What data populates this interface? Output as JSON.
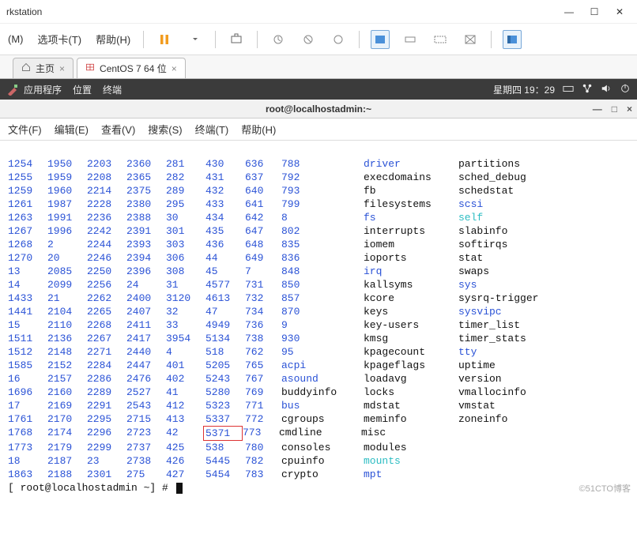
{
  "window": {
    "title": "rkstation"
  },
  "menubar": {
    "items": [
      {
        "label": "(M)"
      },
      {
        "label": "选项卡(T)"
      },
      {
        "label": "帮助(H)"
      }
    ]
  },
  "tabs": [
    {
      "label": "主页",
      "active": false,
      "has_close": true
    },
    {
      "label": "CentOS 7 64 位",
      "active": true,
      "has_close": true
    }
  ],
  "linux_bar": {
    "apps": "应用程序",
    "place": "位置",
    "term": "终端",
    "clock": "星期四 19：29"
  },
  "terminal": {
    "title": "root@localhostadmin:~",
    "menu": [
      "文件(F)",
      "编辑(E)",
      "查看(V)",
      "搜索(S)",
      "终端(T)",
      "帮助(H)"
    ],
    "prompt": "[ root@localhostadmin ~] #",
    "highlight_cell": "5371",
    "rows": [
      {
        "c0": "1254",
        "c1": "1950",
        "c2": "2203",
        "c3": "2360",
        "c4": "281",
        "c5": "430",
        "c6": "636",
        "c7": "788",
        "c8": "driver",
        "c9": "partitions",
        "cls": {
          "c8": "blue"
        }
      },
      {
        "c0": "1255",
        "c1": "1959",
        "c2": "2208",
        "c3": "2365",
        "c4": "282",
        "c5": "431",
        "c6": "637",
        "c7": "792",
        "c8": "execdomains",
        "c9": "sched_debug"
      },
      {
        "c0": "1259",
        "c1": "1960",
        "c2": "2214",
        "c3": "2375",
        "c4": "289",
        "c5": "432",
        "c6": "640",
        "c7": "793",
        "c8": "fb",
        "c9": "schedstat"
      },
      {
        "c0": "1261",
        "c1": "1987",
        "c2": "2228",
        "c3": "2380",
        "c4": "295",
        "c5": "433",
        "c6": "641",
        "c7": "799",
        "c8": "filesystems",
        "c9": "scsi",
        "cls": {
          "c9": "blue"
        }
      },
      {
        "c0": "1263",
        "c1": "1991",
        "c2": "2236",
        "c3": "2388",
        "c4": "30",
        "c5": "434",
        "c6": "642",
        "c7": "8",
        "c8": "fs",
        "c9": "self",
        "cls": {
          "c8": "blue",
          "c9": "cyan"
        }
      },
      {
        "c0": "1267",
        "c1": "1996",
        "c2": "2242",
        "c3": "2391",
        "c4": "301",
        "c5": "435",
        "c6": "647",
        "c7": "802",
        "c8": "interrupts",
        "c9": "slabinfo"
      },
      {
        "c0": "1268",
        "c1": "2",
        "c2": "2244",
        "c3": "2393",
        "c4": "303",
        "c5": "436",
        "c6": "648",
        "c7": "835",
        "c8": "iomem",
        "c9": "softirqs"
      },
      {
        "c0": "1270",
        "c1": "20",
        "c2": "2246",
        "c3": "2394",
        "c4": "306",
        "c5": "44",
        "c6": "649",
        "c7": "836",
        "c8": "ioports",
        "c9": "stat"
      },
      {
        "c0": "13",
        "c1": "2085",
        "c2": "2250",
        "c3": "2396",
        "c4": "308",
        "c5": "45",
        "c6": "7",
        "c7": "848",
        "c8": "irq",
        "c9": "swaps",
        "cls": {
          "c8": "blue"
        }
      },
      {
        "c0": "14",
        "c1": "2099",
        "c2": "2256",
        "c3": "24",
        "c4": "31",
        "c5": "4577",
        "c6": "731",
        "c7": "850",
        "c8": "kallsyms",
        "c9": "sys",
        "cls": {
          "c9": "blue"
        }
      },
      {
        "c0": "1433",
        "c1": "21",
        "c2": "2262",
        "c3": "2400",
        "c4": "3120",
        "c5": "4613",
        "c6": "732",
        "c7": "857",
        "c8": "kcore",
        "c9": "sysrq-trigger"
      },
      {
        "c0": "1441",
        "c1": "2104",
        "c2": "2265",
        "c3": "2407",
        "c4": "32",
        "c5": "47",
        "c6": "734",
        "c7": "870",
        "c8": "keys",
        "c9": "sysvipc",
        "cls": {
          "c9": "blue"
        }
      },
      {
        "c0": "15",
        "c1": "2110",
        "c2": "2268",
        "c3": "2411",
        "c4": "33",
        "c5": "4949",
        "c6": "736",
        "c7": "9",
        "c8": "key-users",
        "c9": "timer_list"
      },
      {
        "c0": "1511",
        "c1": "2136",
        "c2": "2267",
        "c3": "2417",
        "c4": "3954",
        "c5": "5134",
        "c6": "738",
        "c7": "930",
        "c8": "kmsg",
        "c9": "timer_stats"
      },
      {
        "c0": "1512",
        "c1": "2148",
        "c2": "2271",
        "c3": "2440",
        "c4": "4",
        "c5": "518",
        "c6": "762",
        "c7": "95",
        "c8": "kpagecount",
        "c9": "tty",
        "cls": {
          "c9": "blue"
        }
      },
      {
        "c0": "1585",
        "c1": "2152",
        "c2": "2284",
        "c3": "2447",
        "c4": "401",
        "c5": "5205",
        "c6": "765",
        "c7": "acpi",
        "c8": "kpageflags",
        "c9": "uptime",
        "cls": {
          "c7": "blue"
        }
      },
      {
        "c0": "16",
        "c1": "2157",
        "c2": "2286",
        "c3": "2476",
        "c4": "402",
        "c5": "5243",
        "c6": "767",
        "c7": "asound",
        "c8": "loadavg",
        "c9": "version",
        "cls": {
          "c7": "blue"
        }
      },
      {
        "c0": "1696",
        "c1": "2160",
        "c2": "2289",
        "c3": "2527",
        "c4": "41",
        "c5": "5280",
        "c6": "769",
        "c7": "buddyinfo",
        "c8": "locks",
        "c9": "vmallocinfo"
      },
      {
        "c0": "17",
        "c1": "2169",
        "c2": "2291",
        "c3": "2543",
        "c4": "412",
        "c5": "5323",
        "c6": "771",
        "c7": "bus",
        "c8": "mdstat",
        "c9": "vmstat",
        "cls": {
          "c7": "blue"
        }
      },
      {
        "c0": "1761",
        "c1": "2170",
        "c2": "2295",
        "c3": "2715",
        "c4": "413",
        "c5": "5337",
        "c6": "772",
        "c7": "cgroups",
        "c8": "meminfo",
        "c9": "zoneinfo"
      },
      {
        "c0": "1768",
        "c1": "2174",
        "c2": "2296",
        "c3": "2723",
        "c4": "42",
        "c5": "5371",
        "c6": "773",
        "c7": "cmdline",
        "c8": "misc",
        "c9": "",
        "cls": {
          "c5": "boxed blue"
        }
      },
      {
        "c0": "1773",
        "c1": "2179",
        "c2": "2299",
        "c3": "2737",
        "c4": "425",
        "c5": "538",
        "c6": "780",
        "c7": "consoles",
        "c8": "modules",
        "c9": ""
      },
      {
        "c0": "18",
        "c1": "2187",
        "c2": "23",
        "c3": "2738",
        "c4": "426",
        "c5": "5445",
        "c6": "782",
        "c7": "cpuinfo",
        "c8": "mounts",
        "c9": "",
        "cls": {
          "c8": "cyan"
        }
      },
      {
        "c0": "1863",
        "c1": "2188",
        "c2": "2301",
        "c3": "275",
        "c4": "427",
        "c5": "5454",
        "c6": "783",
        "c7": "crypto",
        "c8": "mpt",
        "c9": "",
        "cls": {
          "c8": "blue"
        }
      }
    ]
  },
  "watermark": "©51CTO博客"
}
